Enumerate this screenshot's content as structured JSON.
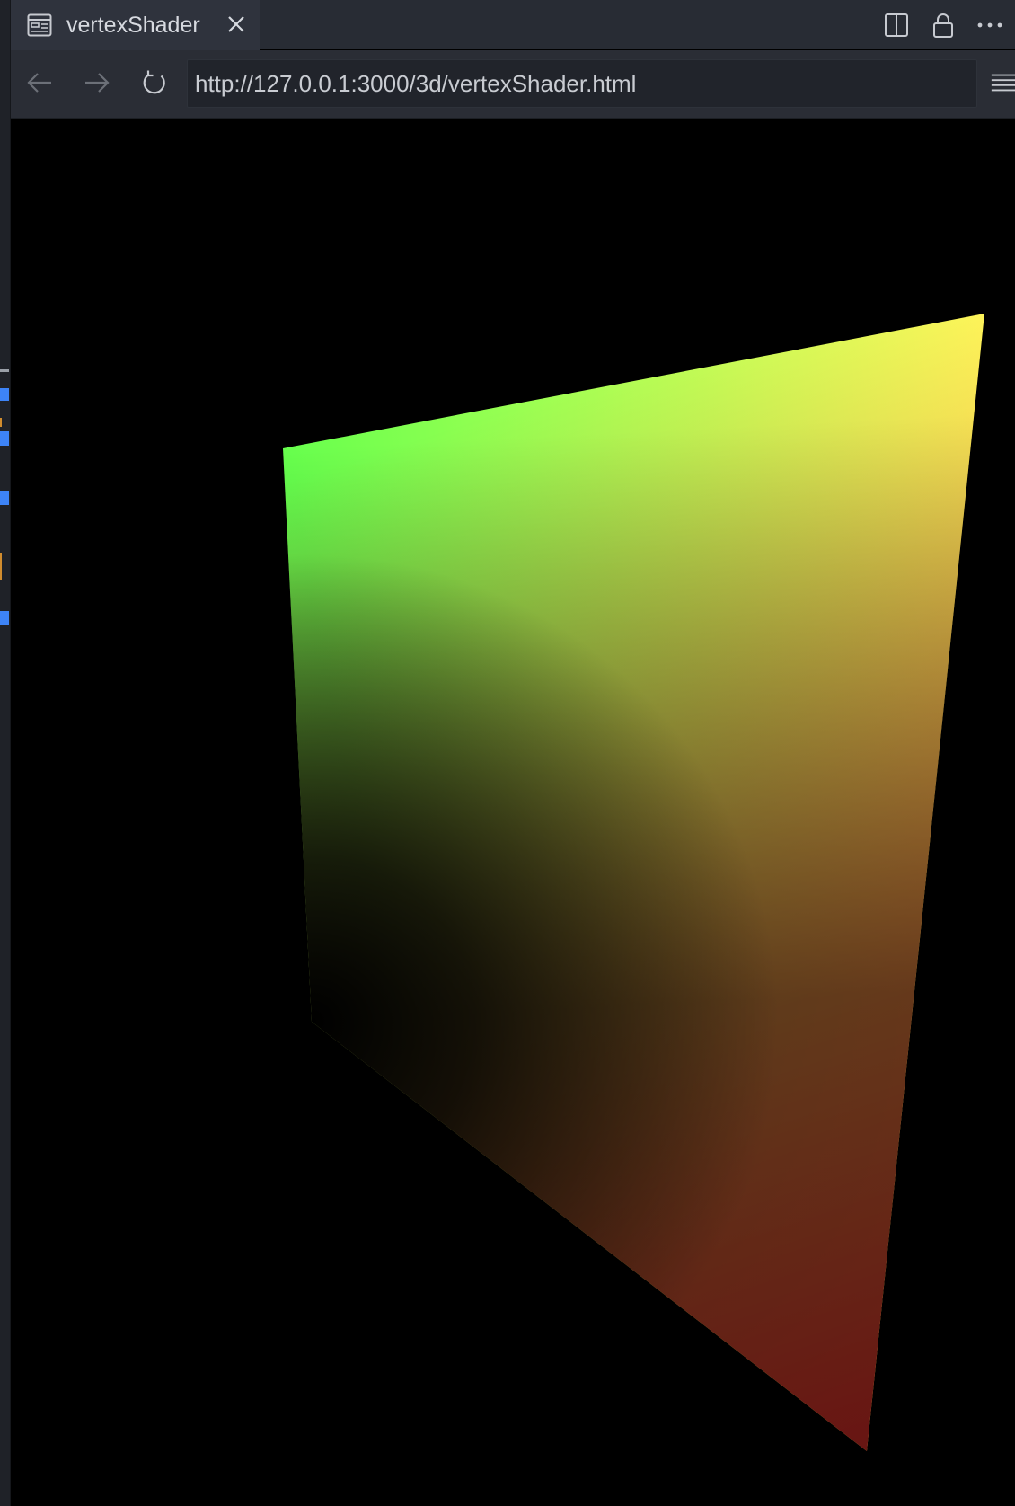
{
  "tab": {
    "title": "vertexShader",
    "icon": "preview-icon"
  },
  "tab_actions": [
    {
      "name": "split-editor-icon"
    },
    {
      "name": "lock-icon"
    },
    {
      "name": "more-actions-icon"
    }
  ],
  "nav": {
    "back_icon": "arrow-left-icon",
    "forward_icon": "arrow-right-icon",
    "reload_icon": "reload-icon",
    "menu_icon": "menu-icon",
    "url": "http://127.0.0.1:3000/3d/vertexShader.html"
  },
  "canvas": {
    "background": "#000000",
    "quad_vertex_colors": {
      "top_left": "#66ff4d",
      "top_right": "#ffff5c",
      "bottom_left": "#000000",
      "bottom_right": "#e8302a"
    }
  },
  "colors": {
    "chrome_dark": "#282c34",
    "tab_active": "#2f333d",
    "gutter_marker": "#3d84f7"
  }
}
